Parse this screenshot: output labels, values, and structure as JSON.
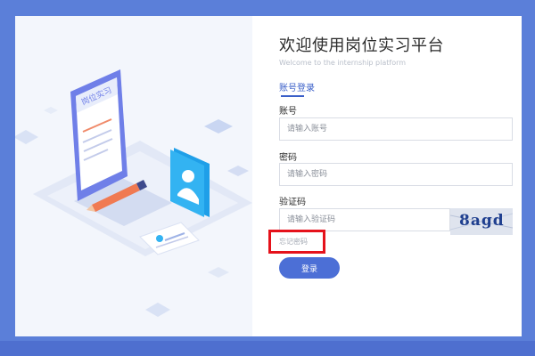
{
  "login": {
    "title": "欢迎使用岗位实习平台",
    "subtitle": "Welcome to the internship platform",
    "tab_label": "账号登录",
    "account_label": "账号",
    "account_placeholder": "请输入账号",
    "password_label": "密码",
    "password_placeholder": "请输入密码",
    "captcha_label": "验证码",
    "captcha_placeholder": "请输入验证码",
    "captcha_text": "8agd",
    "forgot_link": "忘记密码",
    "login_button": "登录"
  },
  "illustration": {
    "tablet_label": "岗位实习"
  },
  "colors": {
    "frame": "#5b7fd9",
    "accent": "#4c6fd6",
    "highlight": "#e5121b"
  }
}
